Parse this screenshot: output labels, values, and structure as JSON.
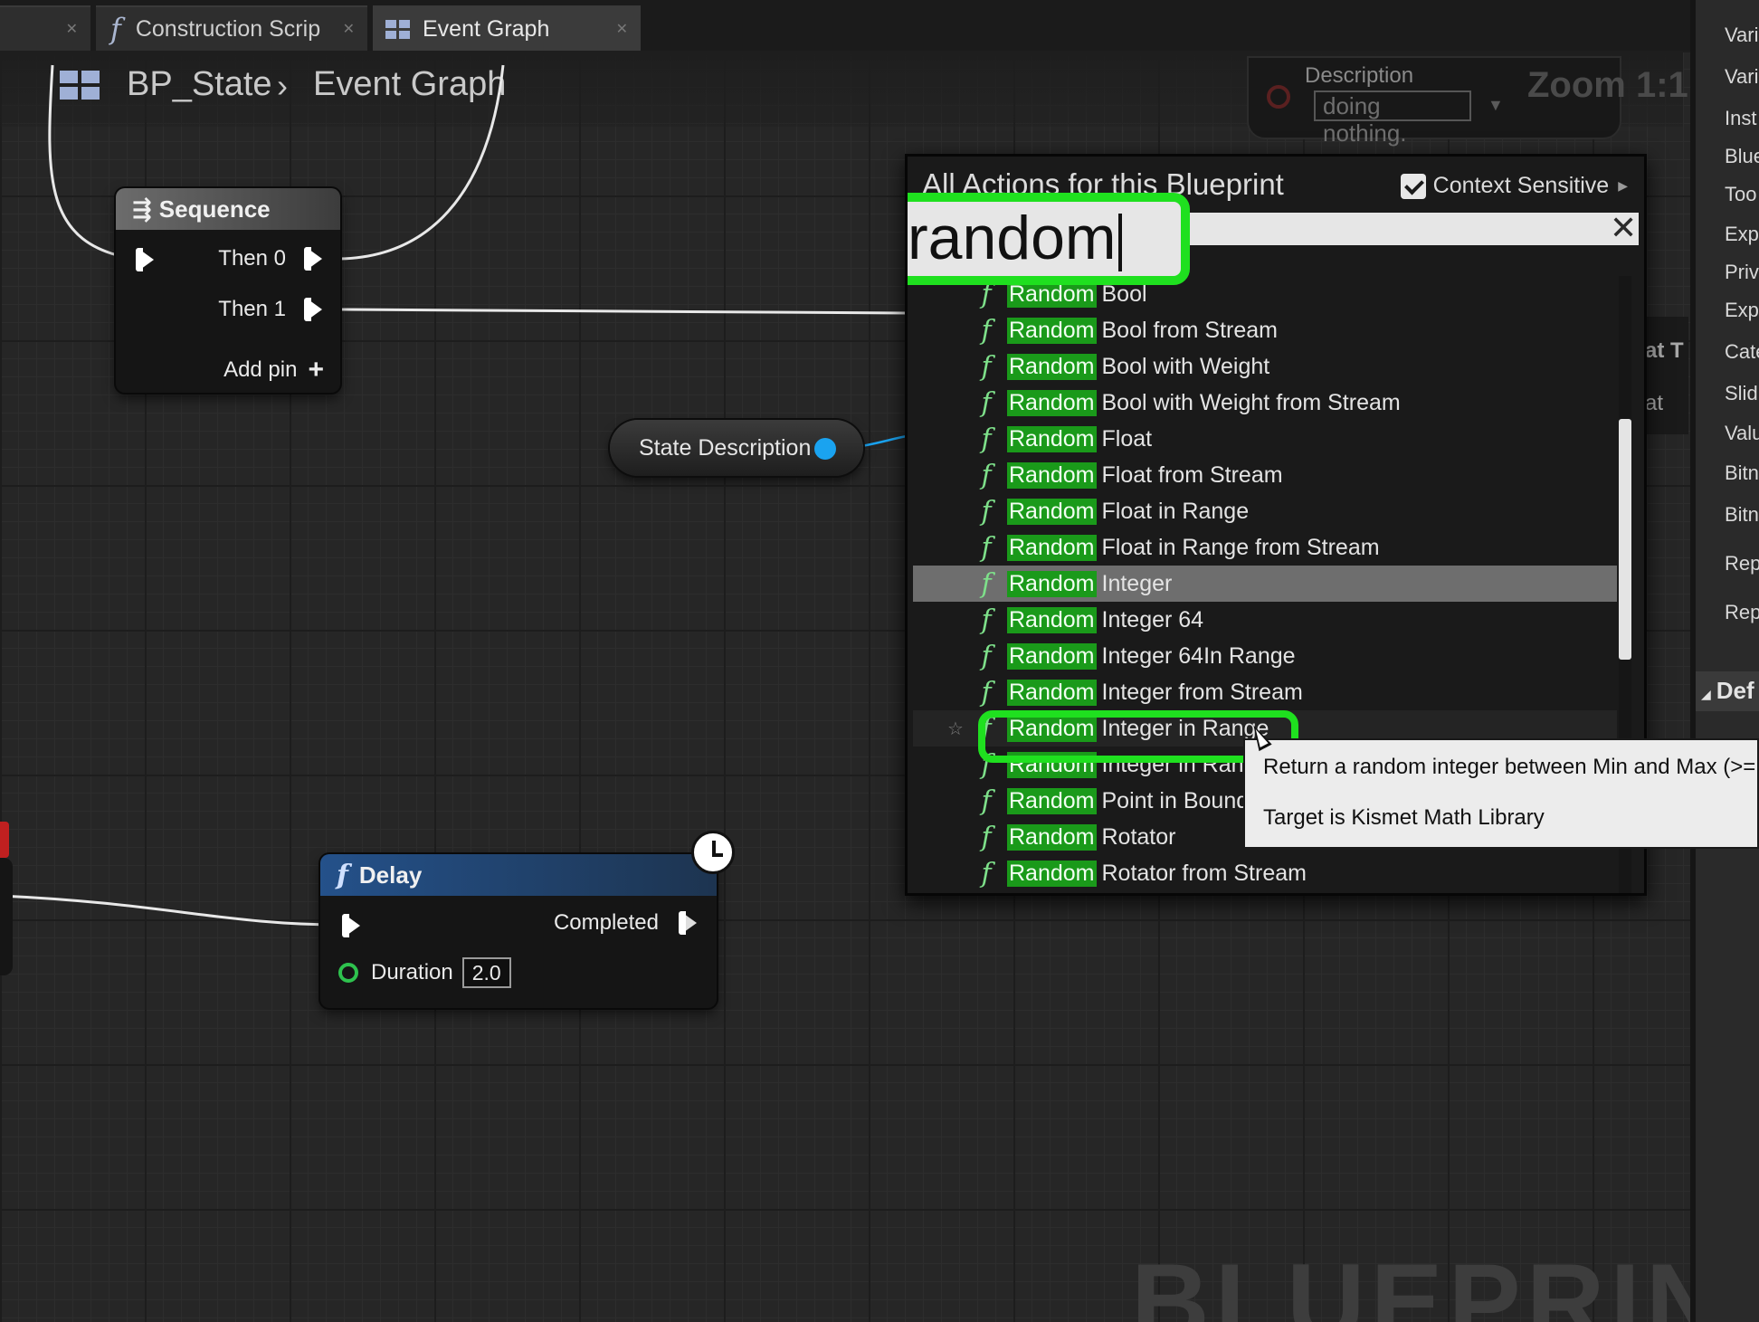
{
  "tabs": [
    {
      "label": "Construction Scrip",
      "icon": "function-icon"
    },
    {
      "label": "Event Graph",
      "icon": "event-graph-icon"
    }
  ],
  "breadcrumb": {
    "blueprint": "BP_State",
    "graph": "Event Graph"
  },
  "zoom": "Zoom 1:1",
  "description_panel": {
    "label": "Description",
    "value": "doing nothing."
  },
  "watermark": "BLUEPRINT",
  "sequence_node": {
    "title": "Sequence",
    "then0": "Then 0",
    "then1": "Then 1",
    "add_pin": "Add pin"
  },
  "state_description_node": {
    "label": "State Description"
  },
  "delay_node": {
    "title": "Delay",
    "completed": "Completed",
    "duration_label": "Duration",
    "duration_value": "2.0"
  },
  "action_menu": {
    "title": "All Actions for this Blueprint",
    "context_sensitive": "Context Sensitive",
    "context_sensitive_checked": true,
    "search_value": "random",
    "highlight": "Random",
    "items": [
      {
        "rest": "Bool"
      },
      {
        "rest": "Bool from Stream"
      },
      {
        "rest": "Bool with Weight"
      },
      {
        "rest": "Bool with Weight from Stream"
      },
      {
        "rest": "Float"
      },
      {
        "rest": "Float from Stream"
      },
      {
        "rest": "Float in Range"
      },
      {
        "rest": "Float in Range from Stream"
      },
      {
        "rest": "Integer",
        "selected": true
      },
      {
        "rest": "Integer 64"
      },
      {
        "rest": "Integer 64In Range"
      },
      {
        "rest": "Integer from Stream"
      },
      {
        "rest": "Integer in Range",
        "hovered": true
      },
      {
        "rest": "Integer in Ran"
      },
      {
        "rest": "Point in Bound"
      },
      {
        "rest": "Rotator"
      },
      {
        "rest": "Rotator from Stream"
      }
    ]
  },
  "tooltip": {
    "line1": "Return a random integer between Min and Max (>=",
    "line2": "Target is Kismet Math Library"
  },
  "right_panel": {
    "items": [
      "Vari",
      "Vari",
      "Inst",
      "Blue",
      "Too",
      "Exp",
      "Priv",
      "Exp",
      "Cate",
      "Slid",
      "Valu",
      "Bitn",
      "Bitn",
      "Rep",
      "Rep"
    ],
    "section": "Def"
  },
  "obscured_node": {
    "title_fragment": "at T",
    "pin_fragment": "at"
  },
  "colors": {
    "highlight_green": "#1fe01f",
    "exec_white": "#ffffff",
    "data_pin_blue": "#1aa3f0",
    "int_pin_green": "#2ec24e"
  }
}
